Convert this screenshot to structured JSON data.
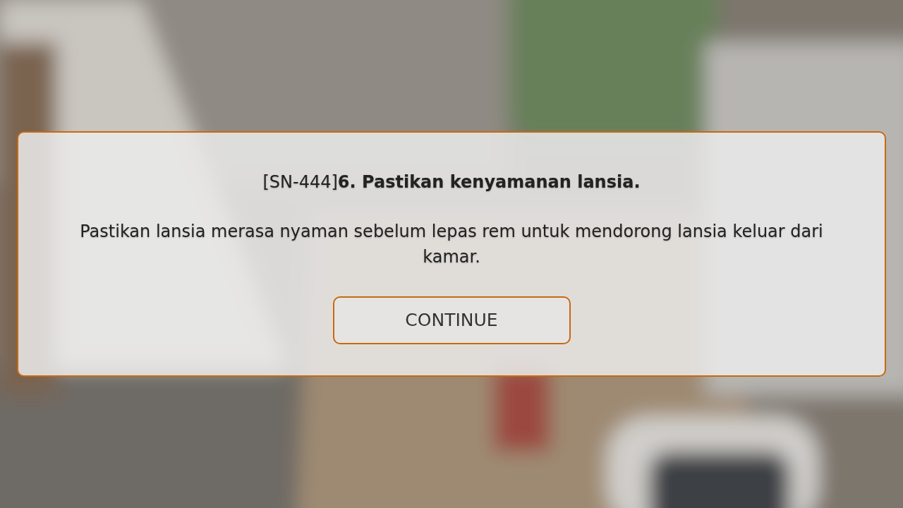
{
  "dialog": {
    "title": "[SN-444]**6. Pastikan kenyamanan lansia.**",
    "message": "Pastikan lansia merasa nyaman sebelum lepas rem untuk mendorong lansia keluar dari kamar.",
    "buttons": [
      {
        "label": "CONTINUE"
      }
    ]
  }
}
